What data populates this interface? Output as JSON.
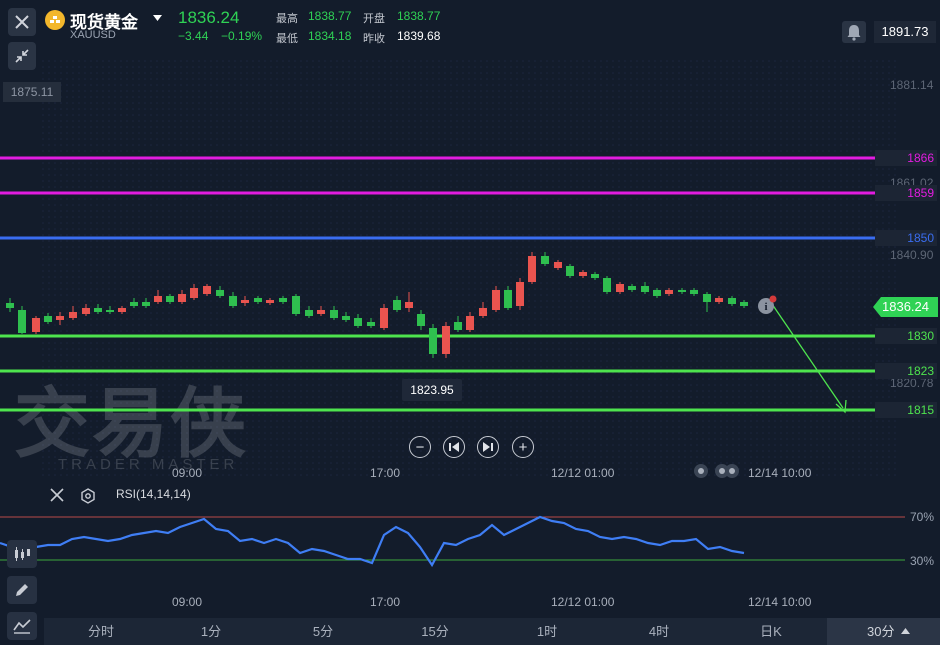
{
  "header": {
    "title": "现货黄金",
    "symbol": "XAUUSD",
    "price": "1836.24",
    "change": "−3.44",
    "change_pct": "−0.19%",
    "high_label": "最高",
    "high_value": "1838.77",
    "open_label": "开盘",
    "open_value": "1838.77",
    "low_label": "最低",
    "low_value": "1834.18",
    "prev_close_label": "昨收",
    "prev_close_value": "1839.68",
    "top_right_price": "1891.73"
  },
  "axis": {
    "price_labels": [
      "1881.14",
      "1861.02",
      "1840.90",
      "1820.78"
    ],
    "left_tag": "1875.11"
  },
  "levels": [
    {
      "value": "1866",
      "color": "#e21ce0"
    },
    {
      "value": "1859",
      "color": "#e21ce0"
    },
    {
      "value": "1850",
      "color": "#3a6df0"
    },
    {
      "value": "1830",
      "color": "#4ee44e"
    },
    {
      "value": "1823",
      "color": "#4ee44e"
    },
    {
      "value": "1815",
      "color": "#4ee44e"
    }
  ],
  "current_price_tag": "1836.24",
  "low_marker": "1823.95",
  "time_axis": [
    "09:00",
    "17:00",
    "12/12 01:00",
    "12/14 10:00"
  ],
  "rsi": {
    "label": "RSI(14,14,14)",
    "upper": "70%",
    "lower": "30%",
    "line_color": "#3f7ef5",
    "upper_color": "#b94a4a",
    "lower_color": "#3ea83e"
  },
  "watermark": {
    "main": "交易侠",
    "sub": "TRADER MASTER"
  },
  "timeframes": [
    "分时",
    "1分",
    "5分",
    "15分",
    "1时",
    "4时",
    "日K"
  ],
  "active_timeframe": "30分",
  "colors": {
    "up": "#e9544f",
    "down": "#2fbf4f",
    "accent_green": "#2fd255"
  }
}
